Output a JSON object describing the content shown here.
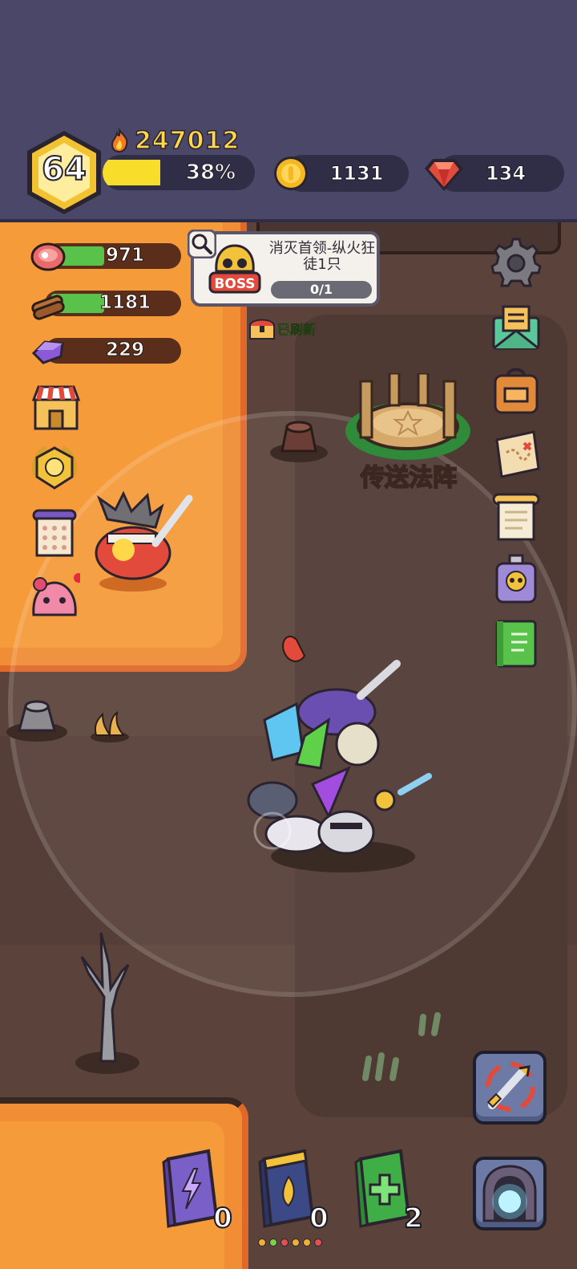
{
  "player": {
    "level": "64",
    "power": "247012",
    "xp_percent": "38%",
    "xp_fraction": 0.38
  },
  "currency": {
    "coins": "1131",
    "gems": "134"
  },
  "resources": {
    "meat": "971",
    "wood": "1181",
    "ore": "229"
  },
  "quest": {
    "badge": "BOSS",
    "title": "消灭首领-纵火狂徒1只",
    "progress": "0/1"
  },
  "refresh_status": "已刷新",
  "portal_label": "传送法阵",
  "skill_books": [
    {
      "name": "lightning-book",
      "count": "0",
      "color": "#7b5fc8"
    },
    {
      "name": "fire-book",
      "count": "0",
      "color": "#3b4a86"
    },
    {
      "name": "heal-book",
      "count": "2",
      "color": "#3fae46"
    }
  ],
  "page_dots": [
    "#f0b030",
    "#7cd04a",
    "#e45050",
    "#f0b030",
    "#f0b030",
    "#e45050"
  ],
  "colors": {
    "topbar": "#4a4769",
    "xp_fill": "#f8dd2a",
    "power_text": "#ffd84a",
    "orange_ground": "#f59b3a",
    "dirt": "#5b433b"
  }
}
